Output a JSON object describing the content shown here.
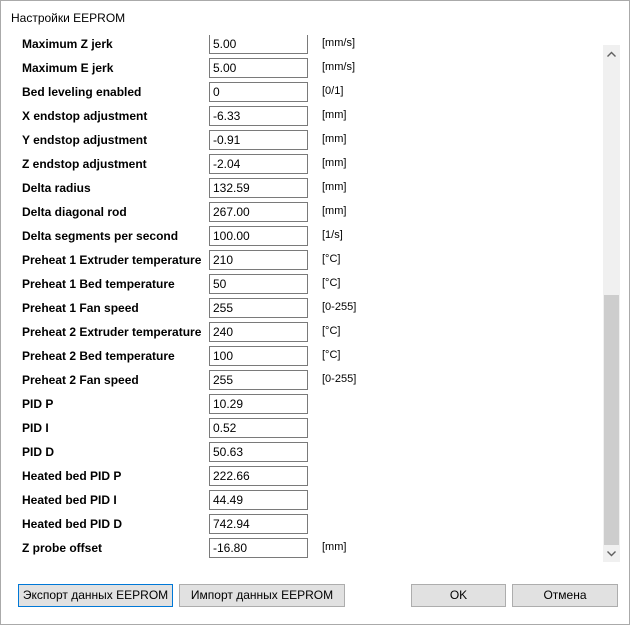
{
  "window": {
    "title": "Настройки EEPROM"
  },
  "settings": [
    {
      "label": "Maximum Z jerk",
      "value": "5.00",
      "unit": "[mm/s]"
    },
    {
      "label": "Maximum E jerk",
      "value": "5.00",
      "unit": "[mm/s]"
    },
    {
      "label": "Bed leveling enabled",
      "value": "0",
      "unit": "[0/1]"
    },
    {
      "label": "X endstop adjustment",
      "value": "-6.33",
      "unit": "[mm]"
    },
    {
      "label": "Y endstop adjustment",
      "value": "-0.91",
      "unit": "[mm]"
    },
    {
      "label": "Z endstop adjustment",
      "value": "-2.04",
      "unit": "[mm]"
    },
    {
      "label": "Delta radius",
      "value": "132.59",
      "unit": "[mm]"
    },
    {
      "label": "Delta diagonal rod",
      "value": "267.00",
      "unit": "[mm]"
    },
    {
      "label": "Delta segments per second",
      "value": "100.00",
      "unit": "[1/s]"
    },
    {
      "label": "Preheat 1 Extruder temperature",
      "value": "210",
      "unit": "[°C]"
    },
    {
      "label": "Preheat 1 Bed temperature",
      "value": "50",
      "unit": "[°C]"
    },
    {
      "label": "Preheat 1 Fan speed",
      "value": "255",
      "unit": "[0-255]"
    },
    {
      "label": "Preheat 2 Extruder temperature",
      "value": "240",
      "unit": "[°C]"
    },
    {
      "label": "Preheat 2 Bed temperature",
      "value": "100",
      "unit": "[°C]"
    },
    {
      "label": "Preheat 2 Fan speed",
      "value": "255",
      "unit": "[0-255]"
    },
    {
      "label": "PID P",
      "value": "10.29",
      "unit": ""
    },
    {
      "label": "PID I",
      "value": "0.52",
      "unit": ""
    },
    {
      "label": "PID D",
      "value": "50.63",
      "unit": ""
    },
    {
      "label": "Heated bed PID P",
      "value": "222.66",
      "unit": ""
    },
    {
      "label": "Heated bed PID I",
      "value": "44.49",
      "unit": ""
    },
    {
      "label": "Heated bed PID D",
      "value": "742.94",
      "unit": ""
    },
    {
      "label": "Z probe offset",
      "value": "-16.80",
      "unit": "[mm]"
    }
  ],
  "scrollbar": {
    "up_icon": "chevron-up-icon",
    "down_icon": "chevron-down-icon",
    "position_fraction": 0.5
  },
  "buttons": {
    "export_label": "Экспорт данных EEPROM",
    "import_label": "Импорт данных EEPROM",
    "ok_label": "OK",
    "cancel_label": "Отмена"
  }
}
